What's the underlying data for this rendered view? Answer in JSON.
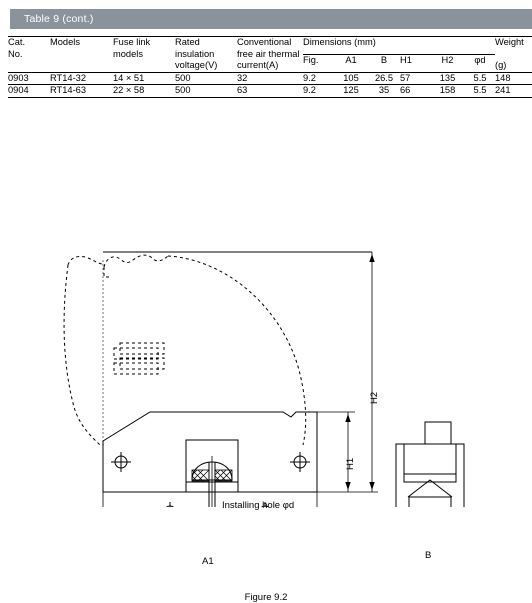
{
  "banner": {
    "title": "Table 9 (cont.)"
  },
  "table": {
    "headers": {
      "cat_no": [
        "Cat.",
        "No."
      ],
      "models": [
        "Models"
      ],
      "fuse_link": [
        "Fuse link",
        "models"
      ],
      "rated_voltage": [
        "Rated",
        "insulation",
        "voltage(V)"
      ],
      "conventional": [
        "Conventional",
        "free air thermal",
        "current(A)"
      ],
      "dimensions_group": "Dimensions (mm)",
      "dim_cols": [
        "Fig.",
        "A1",
        "B",
        "H1",
        "H2",
        "φd"
      ],
      "weight": [
        "Weight",
        "(g)"
      ]
    },
    "rows": [
      {
        "cat_no": "0903",
        "models": "RT14-32",
        "fuse_link": "14 × 51",
        "rated_voltage": "500",
        "conventional": "32",
        "fig": "9.2",
        "a1": "105",
        "b": "26.5",
        "h1": "57",
        "h2": "135",
        "phi_d": "5.5",
        "weight": "148"
      },
      {
        "cat_no": "0904",
        "models": "RT14-63",
        "fuse_link": "22 × 58",
        "rated_voltage": "500",
        "conventional": "63",
        "fig": "9.2",
        "a1": "125",
        "b": "35",
        "h1": "66",
        "h2": "158",
        "phi_d": "5.5",
        "weight": "241"
      }
    ]
  },
  "drawing": {
    "caption": "Figure 9.2",
    "labels": {
      "h2": "H2",
      "h1": "H1",
      "a1": "A1",
      "b": "B",
      "installing_hole": "Installing hole φd"
    }
  },
  "colors": {
    "banner_bg": "#8a939c",
    "banner_text": "#ffffff",
    "line": "#000000",
    "page_bg": "#ffffff"
  }
}
